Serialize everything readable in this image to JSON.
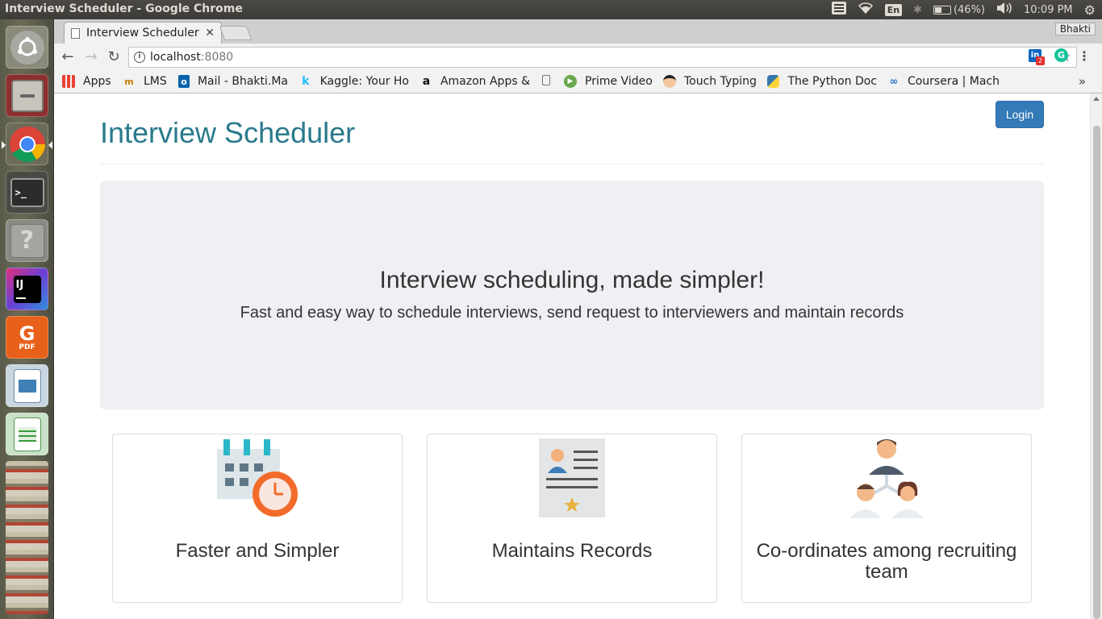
{
  "os": {
    "window_title": "Interview Scheduler - Google Chrome",
    "keyboard_layout": "En",
    "battery": "(46%)",
    "clock": "10:09 PM"
  },
  "browser": {
    "tab_title": "Interview Scheduler",
    "profile_name": "Bhakti",
    "url_host": "localhost",
    "url_port": ":8080",
    "linkedin_badge": "2",
    "bookmarks": [
      {
        "label": "Apps"
      },
      {
        "label": "LMS"
      },
      {
        "label": "Mail - Bhakti.Ma"
      },
      {
        "label": "Kaggle: Your Ho"
      },
      {
        "label": "Amazon Apps &"
      },
      {
        "label": ""
      },
      {
        "label": "Prime Video"
      },
      {
        "label": "Touch Typing"
      },
      {
        "label": "The Python Doc"
      },
      {
        "label": "Coursera | Mach"
      }
    ],
    "more_bookmarks": "»"
  },
  "page": {
    "login_label": "Login",
    "title": "Interview Scheduler",
    "hero": {
      "heading": "Interview scheduling, made simpler!",
      "subtext": "Fast and easy way to schedule interviews, send request to interviewers and maintain records"
    },
    "features": [
      {
        "caption": "Faster and Simpler",
        "icon": "calendar-clock-icon"
      },
      {
        "caption": "Maintains Records",
        "icon": "resume-document-icon"
      },
      {
        "caption": "Co-ordinates among recruiting team",
        "icon": "team-hierarchy-icon"
      }
    ]
  },
  "colors": {
    "title_teal": "#2a7a8c",
    "login_blue": "#337ab7",
    "jumbotron_bg": "#eff0f3"
  }
}
